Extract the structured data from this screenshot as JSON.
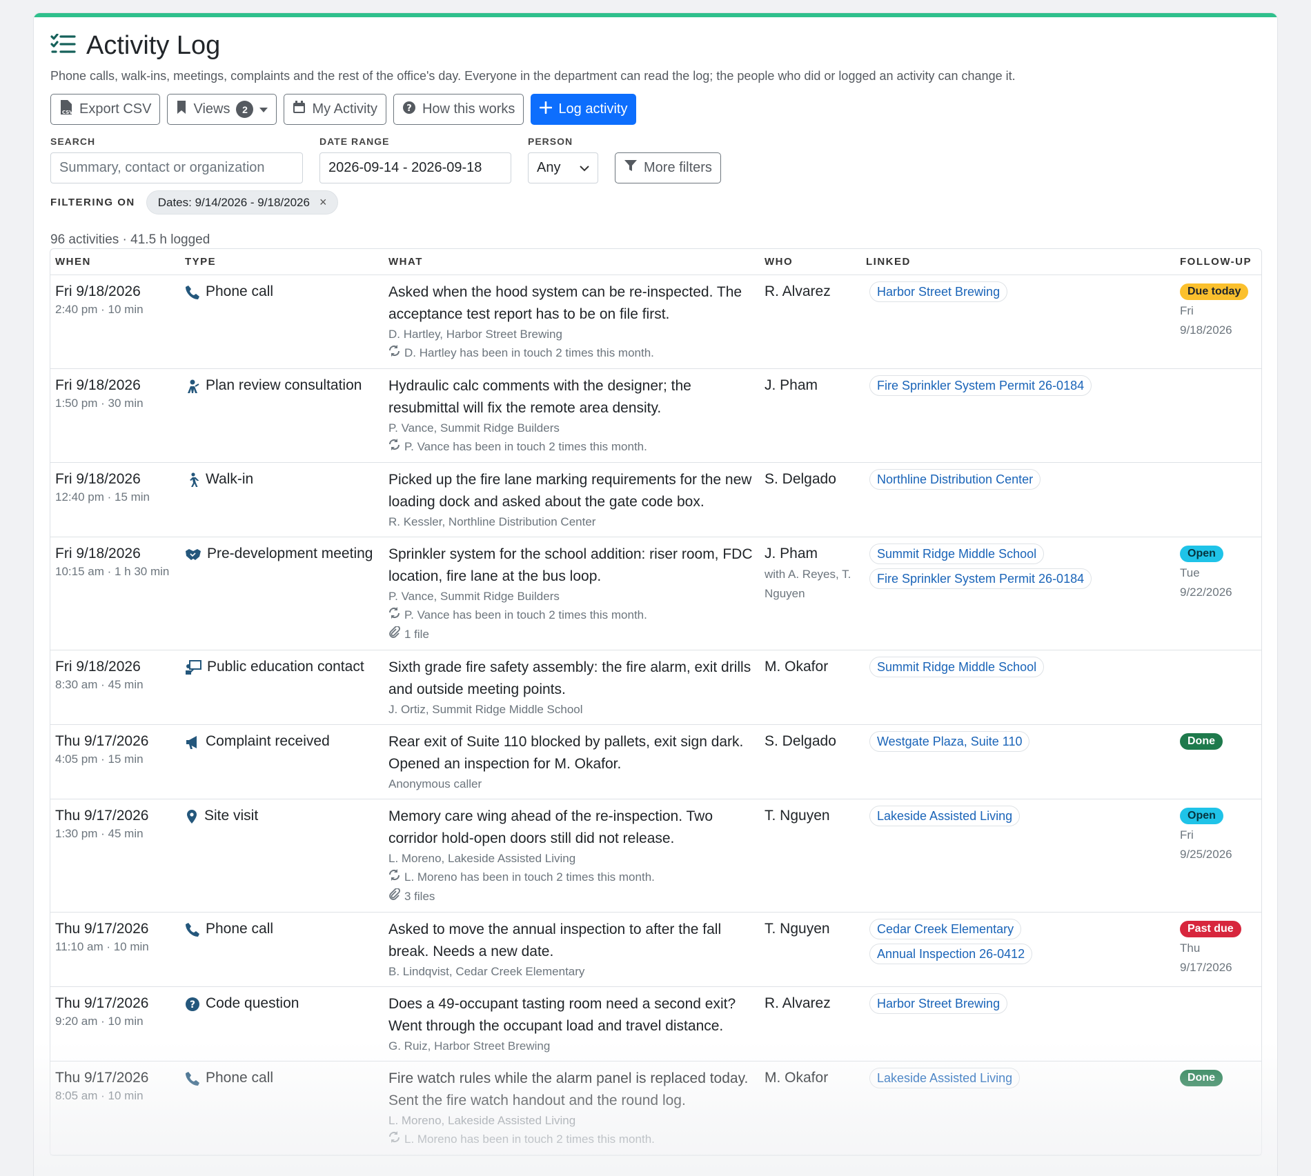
{
  "page": {
    "title": "Activity Log",
    "subtitle": "Phone calls, walk-ins, meetings, complaints and the rest of the office's day. Everyone in the department can read the log; the people who did or logged an activity can change it."
  },
  "toolbar": {
    "export_label": "Export CSV",
    "views_label": "Views",
    "views_count": "2",
    "my_activity_label": "My Activity",
    "how_label": "How this works",
    "log_label": "Log activity"
  },
  "filters": {
    "search_label": "SEARCH",
    "search_placeholder": "Summary, contact or organization",
    "date_label": "DATE RANGE",
    "date_value": "2026-09-14 - 2026-09-18",
    "person_label": "PERSON",
    "person_value": "Any",
    "more_label": "More filters",
    "filtering_on_label": "FILTERING ON",
    "active_chip": "Dates: 9/14/2026 - 9/18/2026",
    "remove_glyph": "×"
  },
  "summary": "96 activities · 41.5 h logged",
  "columns": [
    "WHEN",
    "TYPE",
    "WHAT",
    "WHO",
    "LINKED",
    "FOLLOW-UP"
  ],
  "rows": [
    {
      "date": "Fri 9/18/2026",
      "time": "2:40 pm · 10 min",
      "type": "Phone call",
      "icon": "phone",
      "what": "Asked when the hood system can be re-inspected. The acceptance test report has to be on file first.",
      "contact": "D. Hartley, Harbor Street Brewing",
      "touch": "D. Hartley has been in touch 2 times this month.",
      "files": "",
      "who": "R. Alvarez",
      "who_extra": "",
      "links": [
        "Harbor Street Brewing"
      ],
      "status": "Due today",
      "status_kind": "due",
      "fday": "Fri",
      "fdate": "9/18/2026"
    },
    {
      "date": "Fri 9/18/2026",
      "time": "1:50 pm · 30 min",
      "type": "Plan review consultation",
      "icon": "consult",
      "what": "Hydraulic calc comments with the designer; the resubmittal will fix the remote area density.",
      "contact": "P. Vance, Summit Ridge Builders",
      "touch": "P. Vance has been in touch 2 times this month.",
      "files": "",
      "who": "J. Pham",
      "who_extra": "",
      "links": [
        "Fire Sprinkler System Permit 26-0184"
      ],
      "status": "",
      "status_kind": "",
      "fday": "",
      "fdate": ""
    },
    {
      "date": "Fri 9/18/2026",
      "time": "12:40 pm · 15 min",
      "type": "Walk-in",
      "icon": "walk",
      "what": "Picked up the fire lane marking requirements for the new loading dock and asked about the gate code box.",
      "contact": "R. Kessler, Northline Distribution Center",
      "touch": "",
      "files": "",
      "who": "S. Delgado",
      "who_extra": "",
      "links": [
        "Northline Distribution Center"
      ],
      "status": "",
      "status_kind": "",
      "fday": "",
      "fdate": ""
    },
    {
      "date": "Fri 9/18/2026",
      "time": "10:15 am · 1 h 30 min",
      "type": "Pre-development meeting",
      "icon": "handshake",
      "what": "Sprinkler system for the school addition: riser room, FDC location, fire lane at the bus loop.",
      "contact": "P. Vance, Summit Ridge Builders",
      "touch": "P. Vance has been in touch 2 times this month.",
      "files": "1 file",
      "who": "J. Pham",
      "who_extra": "with A. Reyes, T. Nguyen",
      "links": [
        "Summit Ridge Middle School",
        "Fire Sprinkler System Permit 26-0184"
      ],
      "status": "Open",
      "status_kind": "open",
      "fday": "Tue",
      "fdate": "9/22/2026"
    },
    {
      "date": "Fri 9/18/2026",
      "time": "8:30 am · 45 min",
      "type": "Public education contact",
      "icon": "teach",
      "what": "Sixth grade fire safety assembly: the fire alarm, exit drills and outside meeting points.",
      "contact": "J. Ortiz, Summit Ridge Middle School",
      "touch": "",
      "files": "",
      "who": "M. Okafor",
      "who_extra": "",
      "links": [
        "Summit Ridge Middle School"
      ],
      "status": "",
      "status_kind": "",
      "fday": "",
      "fdate": ""
    },
    {
      "date": "Thu 9/17/2026",
      "time": "4:05 pm · 15 min",
      "type": "Complaint received",
      "icon": "megaphone",
      "what": "Rear exit of Suite 110 blocked by pallets, exit sign dark. Opened an inspection for M. Okafor.",
      "contact": "Anonymous caller",
      "touch": "",
      "files": "",
      "who": "S. Delgado",
      "who_extra": "",
      "links": [
        "Westgate Plaza, Suite 110"
      ],
      "status": "Done",
      "status_kind": "done",
      "fday": "",
      "fdate": ""
    },
    {
      "date": "Thu 9/17/2026",
      "time": "1:30 pm · 45 min",
      "type": "Site visit",
      "icon": "pin",
      "what": "Memory care wing ahead of the re-inspection. Two corridor hold-open doors still did not release.",
      "contact": "L. Moreno, Lakeside Assisted Living",
      "touch": "L. Moreno has been in touch 2 times this month.",
      "files": "3 files",
      "who": "T. Nguyen",
      "who_extra": "",
      "links": [
        "Lakeside Assisted Living"
      ],
      "status": "Open",
      "status_kind": "open",
      "fday": "Fri",
      "fdate": "9/25/2026"
    },
    {
      "date": "Thu 9/17/2026",
      "time": "11:10 am · 10 min",
      "type": "Phone call",
      "icon": "phone",
      "what": "Asked to move the annual inspection to after the fall break. Needs a new date.",
      "contact": "B. Lindqvist, Cedar Creek Elementary",
      "touch": "",
      "files": "",
      "who": "T. Nguyen",
      "who_extra": "",
      "links": [
        "Cedar Creek Elementary",
        "Annual Inspection 26-0412"
      ],
      "status": "Past due",
      "status_kind": "past",
      "fday": "Thu",
      "fdate": "9/17/2026"
    },
    {
      "date": "Thu 9/17/2026",
      "time": "9:20 am · 10 min",
      "type": "Code question",
      "icon": "question",
      "what": "Does a 49-occupant tasting room need a second exit? Went through the occupant load and travel distance.",
      "contact": "G. Ruiz, Harbor Street Brewing",
      "touch": "",
      "files": "",
      "who": "R. Alvarez",
      "who_extra": "",
      "links": [
        "Harbor Street Brewing"
      ],
      "status": "",
      "status_kind": "",
      "fday": "",
      "fdate": ""
    },
    {
      "date": "Thu 9/17/2026",
      "time": "8:05 am · 10 min",
      "type": "Phone call",
      "icon": "phone",
      "what": "Fire watch rules while the alarm panel is replaced today. Sent the fire watch handout and the round log.",
      "contact": "L. Moreno, Lakeside Assisted Living",
      "touch": "L. Moreno has been in touch 2 times this month.",
      "files": "",
      "who": "M. Okafor",
      "who_extra": "",
      "links": [
        "Lakeside Assisted Living"
      ],
      "status": "Done",
      "status_kind": "done",
      "fday": "",
      "fdate": ""
    }
  ],
  "colors": {
    "accent": "#2fc08c",
    "primary": "#0d6efd",
    "link": "#1a64b8"
  }
}
